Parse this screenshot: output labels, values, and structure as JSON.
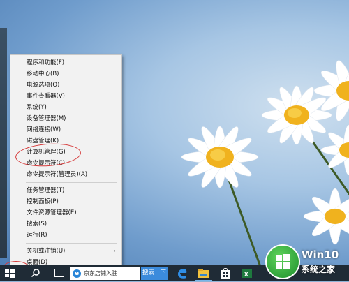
{
  "menu": {
    "items": [
      {
        "label": "程序和功能(F)"
      },
      {
        "label": "移动中心(B)"
      },
      {
        "label": "电源选项(O)"
      },
      {
        "label": "事件查看器(V)"
      },
      {
        "label": "系统(Y)"
      },
      {
        "label": "设备管理器(M)"
      },
      {
        "label": "网络连接(W)"
      },
      {
        "label": "磁盘管理(K)"
      },
      {
        "label": "计算机管理(G)"
      },
      {
        "label": "命令提示符(C)"
      },
      {
        "label": "命令提示符(管理员)(A)"
      },
      {
        "label": "任务管理器(T)"
      },
      {
        "label": "控制面板(P)"
      },
      {
        "label": "文件资源管理器(E)"
      },
      {
        "label": "搜索(S)"
      },
      {
        "label": "运行(R)"
      },
      {
        "label": "关机或注销(U)"
      },
      {
        "label": "桌面(D)"
      }
    ]
  },
  "taskbar": {
    "search_box_text": "京东店铺入驻",
    "search_button_label": "搜索一下"
  },
  "watermark": {
    "title": "Win10",
    "subtitle": "系统之家"
  },
  "colors": {
    "annotation": "#d63a3a",
    "taskbar": "#1f2b36",
    "search_button": "#3b8bdc"
  }
}
